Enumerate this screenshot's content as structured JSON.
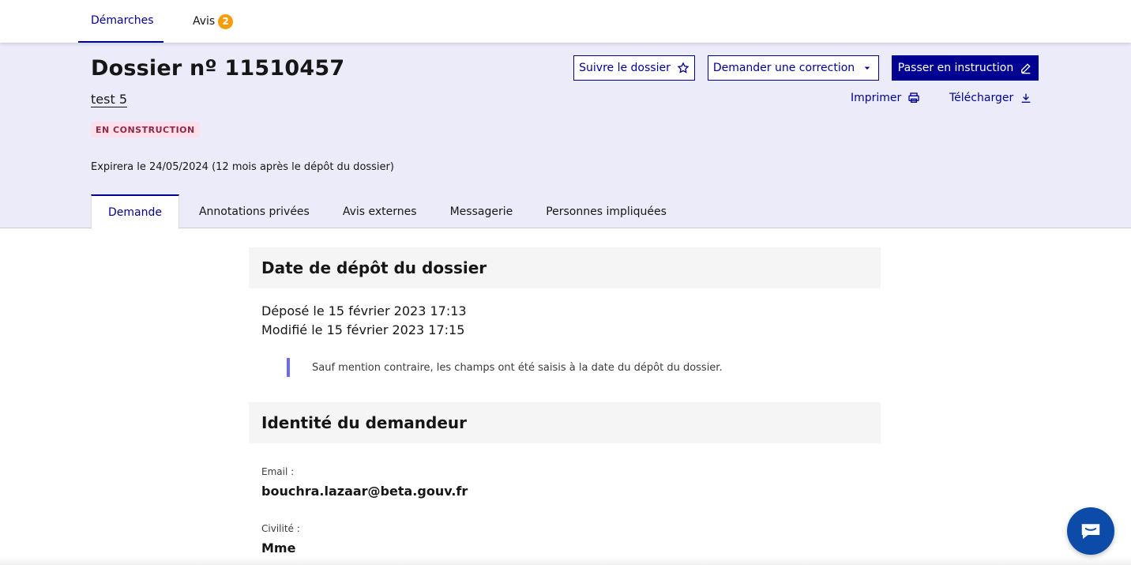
{
  "nav": {
    "demarches": "Démarches",
    "avis": "Avis",
    "avis_count": "2"
  },
  "dossier": {
    "title": "Dossier nº 11510457",
    "name": "test 5",
    "status": "EN CONSTRUCTION",
    "expiry": "Expirera le 24/05/2024 (12 mois après le dépôt du dossier)"
  },
  "actions": {
    "suivre": "Suivre le dossier",
    "correction": "Demander une correction",
    "instruction": "Passer en instruction",
    "imprimer": "Imprimer",
    "telecharger": "Télécharger"
  },
  "tabs": [
    {
      "label": "Demande"
    },
    {
      "label": "Annotations privées"
    },
    {
      "label": "Avis externes"
    },
    {
      "label": "Messagerie"
    },
    {
      "label": "Personnes impliquées"
    }
  ],
  "depot": {
    "heading": "Date de dépôt du dossier",
    "depose": "Déposé le 15 février 2023 17:13",
    "modifie": "Modifié le 15 février 2023 17:15",
    "note": "Sauf mention contraire, les champs ont été saisis à la date du dépôt du dossier."
  },
  "identite": {
    "heading": "Identité du demandeur",
    "email_label": "Email :",
    "email_value": "bouchra.lazaar@beta.gouv.fr",
    "civilite_label": "Civilité :",
    "civilite_value": "Mme"
  },
  "colors": {
    "primary": "#000091",
    "header_bg": "#ecebfa",
    "badge": "#f59e0b",
    "chat": "#0d4ba8"
  },
  "icons": [
    "star-icon",
    "caret-down-icon",
    "pencil-icon",
    "printer-icon",
    "download-icon",
    "chat-icon"
  ]
}
